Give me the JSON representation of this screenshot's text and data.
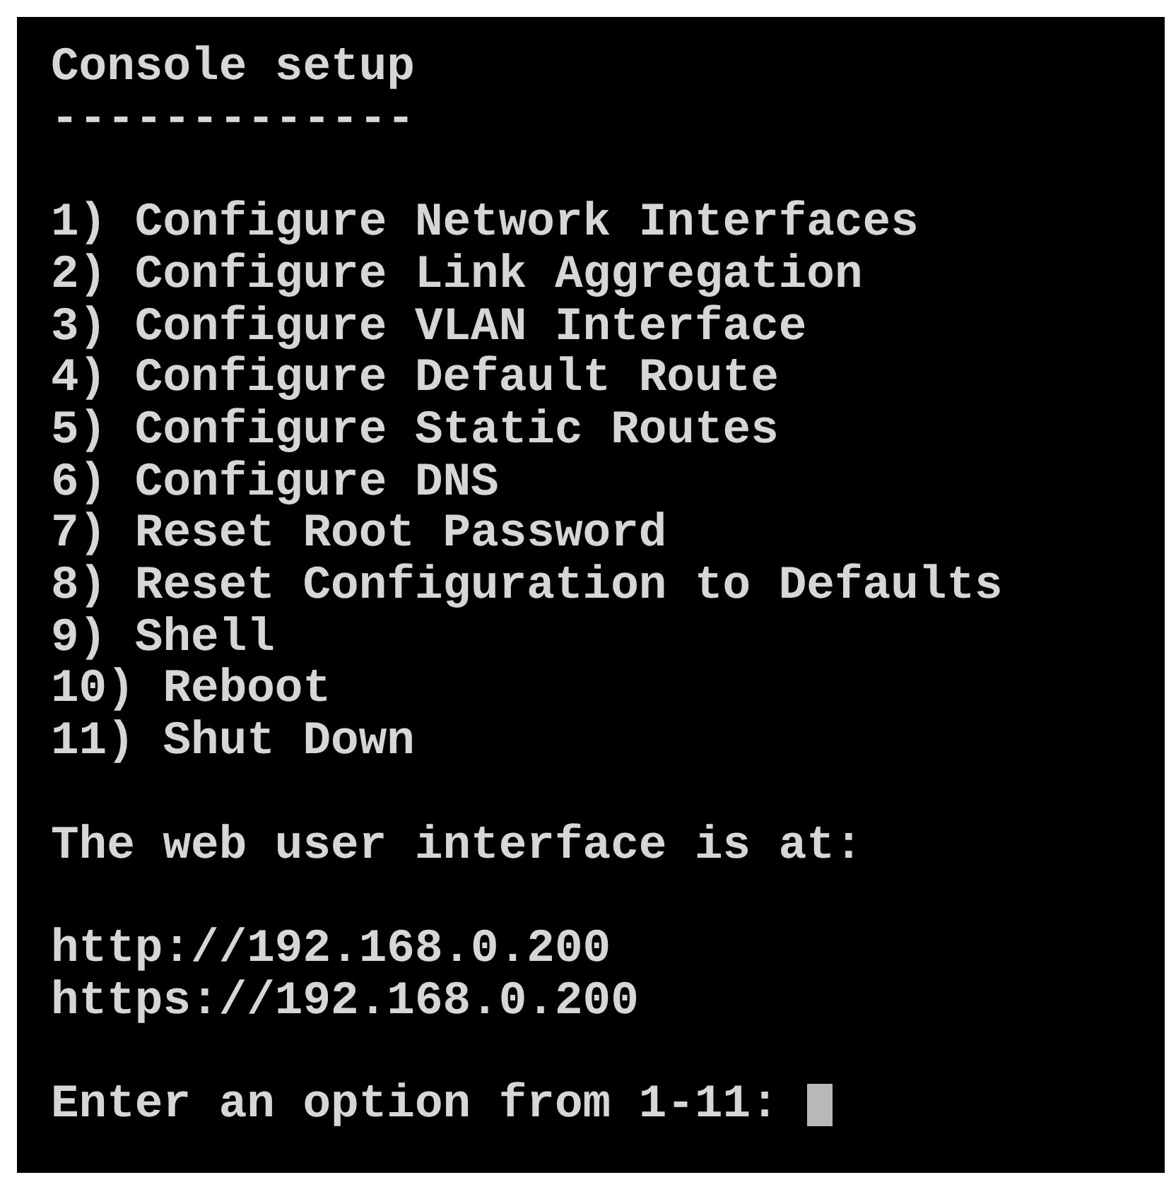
{
  "console": {
    "title": "Console setup",
    "underline": "-------------",
    "menu_items": [
      "1) Configure Network Interfaces",
      "2) Configure Link Aggregation",
      "3) Configure VLAN Interface",
      "4) Configure Default Route",
      "5) Configure Static Routes",
      "6) Configure DNS",
      "7) Reset Root Password",
      "8) Reset Configuration to Defaults",
      "9) Shell",
      "10) Reboot",
      "11) Shut Down"
    ],
    "info_text": "The web user interface is at:",
    "urls": [
      "http://192.168.0.200",
      "https://192.168.0.200"
    ],
    "prompt": "Enter an option from 1-11:"
  }
}
